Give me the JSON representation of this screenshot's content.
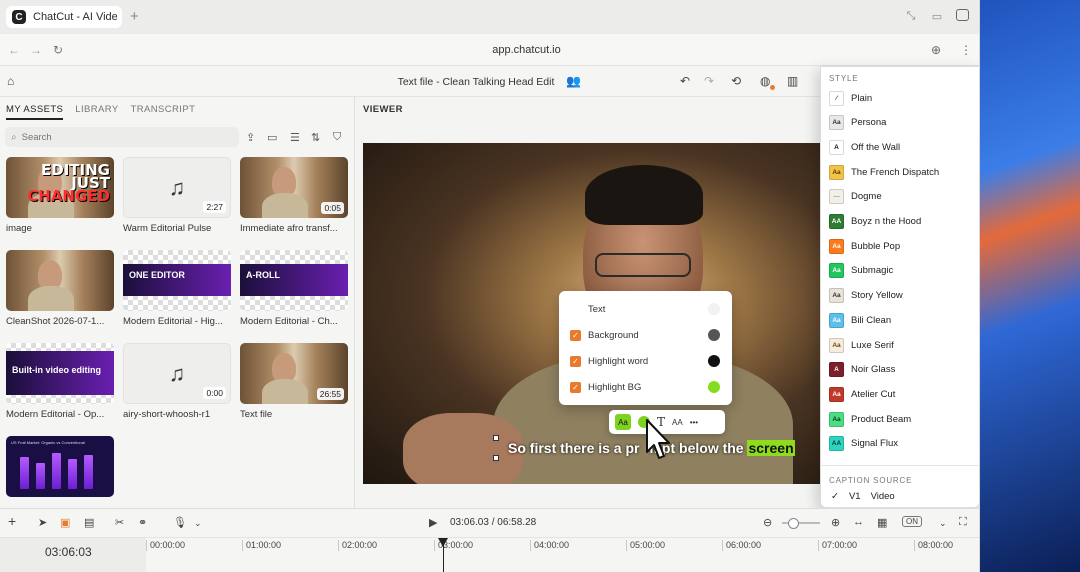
{
  "browser": {
    "tab_title": "ChatCut - AI Video Editor",
    "url": "app.chatcut.io"
  },
  "appbar": {
    "doc_title": "Text file - Clean Talking Head Edit"
  },
  "left_panel": {
    "tabs": [
      "MY ASSETS",
      "LIBRARY",
      "TRANSCRIPT"
    ],
    "search_placeholder": "Search",
    "assets": [
      {
        "name": "image",
        "duration": "",
        "kind": "photo-editing",
        "overlay": [
          "EDITING",
          "JUST",
          "CHANGED"
        ]
      },
      {
        "name": "Warm Editorial Pulse",
        "duration": "2:27",
        "kind": "music"
      },
      {
        "name": "Immediate afro transf...",
        "duration": "0:05",
        "kind": "photo"
      },
      {
        "name": "CleanShot 2026-07-1...",
        "duration": "",
        "kind": "photo"
      },
      {
        "name": "Modern Editorial - Hig...",
        "duration": "",
        "kind": "banner",
        "banner": "ONE EDITOR"
      },
      {
        "name": "Modern Editorial - Ch...",
        "duration": "",
        "kind": "banner",
        "banner": "A-ROLL"
      },
      {
        "name": "Modern Editorial - Op...",
        "duration": "",
        "kind": "banner-big",
        "banner": "Built-in video editing"
      },
      {
        "name": "airy-short-whoosh-r1",
        "duration": "0:00",
        "kind": "music"
      },
      {
        "name": "Text file",
        "duration": "26:55",
        "kind": "photo"
      },
      {
        "name": "",
        "duration": "",
        "kind": "chart",
        "banner": "US Fruit Market: Organic vs Conventional"
      }
    ]
  },
  "viewer": {
    "label": "VIEWER",
    "caption_before": "So first there is a pr",
    "caption_after": "mpt below the ",
    "caption_highlight": "screen"
  },
  "caption_popover": {
    "rows": [
      {
        "label": "Text",
        "checked": false,
        "color": "#f2f2f2"
      },
      {
        "label": "Background",
        "checked": true,
        "color": "#555555"
      },
      {
        "label": "Highlight word",
        "checked": true,
        "color": "#111111"
      },
      {
        "label": "Highlight BG",
        "checked": true,
        "color": "#86dc1e"
      }
    ],
    "toolbar": {
      "aa": "Aa",
      "caps": "AA",
      "more": "•••"
    }
  },
  "style_dropdown": {
    "header": "STYLE",
    "items": [
      {
        "label": "Plain",
        "swatch_bg": "#ffffff",
        "swatch_fg": "#333333",
        "swatch_text": "⁄"
      },
      {
        "label": "Persona",
        "swatch_bg": "#e8e8e8",
        "swatch_fg": "#333333",
        "swatch_text": "Aa"
      },
      {
        "label": "Off the Wall",
        "swatch_bg": "#ffffff",
        "swatch_fg": "#111111",
        "swatch_text": "A"
      },
      {
        "label": "The French Dispatch",
        "swatch_bg": "#f3c24a",
        "swatch_fg": "#5a3a00",
        "swatch_text": "Aa"
      },
      {
        "label": "Dogme",
        "swatch_bg": "#f2efe9",
        "swatch_fg": "#999999",
        "swatch_text": "—"
      },
      {
        "label": "Boyz n the Hood",
        "swatch_bg": "#2e7d32",
        "swatch_fg": "#ffffff",
        "swatch_text": "AA"
      },
      {
        "label": "Bubble Pop",
        "swatch_bg": "#ff7a1a",
        "swatch_fg": "#ffffff",
        "swatch_text": "Aa"
      },
      {
        "label": "Submagic",
        "swatch_bg": "#22c55e",
        "swatch_fg": "#ffffff",
        "swatch_text": "Aa"
      },
      {
        "label": "Story Yellow",
        "swatch_bg": "#e8e3d8",
        "swatch_fg": "#333333",
        "swatch_text": "Aa"
      },
      {
        "label": "Bili Clean",
        "swatch_bg": "#5bc0eb",
        "swatch_fg": "#ffffff",
        "swatch_text": "Aa"
      },
      {
        "label": "Luxe Serif",
        "swatch_bg": "#f5ecd9",
        "swatch_fg": "#6b4a1f",
        "swatch_text": "Aa"
      },
      {
        "label": "Noir Glass",
        "swatch_bg": "#7a1f2b",
        "swatch_fg": "#ffffff",
        "swatch_text": "A"
      },
      {
        "label": "Atelier Cut",
        "swatch_bg": "#c0392b",
        "swatch_fg": "#ffffff",
        "swatch_text": "Aa"
      },
      {
        "label": "Product Beam",
        "swatch_bg": "#4ade80",
        "swatch_fg": "#0b3d1e",
        "swatch_text": "Aa"
      },
      {
        "label": "Signal Flux",
        "swatch_bg": "#2dd4bf",
        "swatch_fg": "#063b35",
        "swatch_text": "AA"
      }
    ],
    "caption_source_header": "CAPTION SOURCE",
    "caption_source": {
      "check": "✓",
      "track": "V1",
      "type": "Video"
    }
  },
  "timeline": {
    "timecode": "03:06.03 / 06:58.28",
    "playhead_time": "03:06:03",
    "captions_toggle": "ON",
    "ticks": [
      "00:00:00",
      "01:00:00",
      "02:00:00",
      "03:00:00",
      "04:00:00",
      "05:00:00",
      "06:00:00",
      "07:00:00",
      "08:00:00"
    ]
  },
  "colors": {
    "accent": "#e87a2c",
    "highlight_green": "#8fdc1e"
  }
}
